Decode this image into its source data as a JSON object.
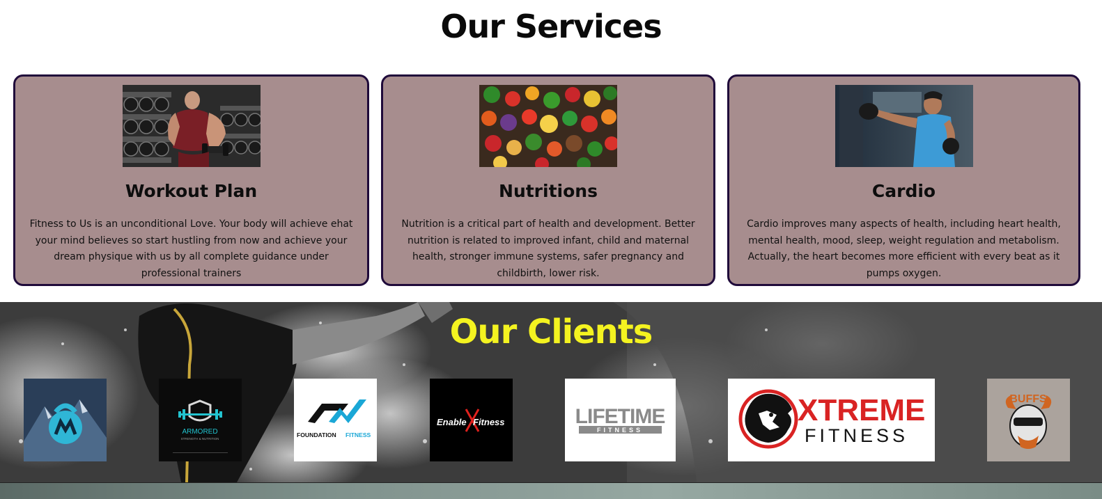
{
  "services": {
    "title": "Our Services",
    "cards": [
      {
        "title": "Workout Plan",
        "description": "Fitness to Us is an unconditional Love. Your body will achieve ehat your mind believes so start hustling from now and achieve your dream physique with us by all complete guidance under professional trainers",
        "image_icon": "bodybuilder-photo"
      },
      {
        "title": "Nutritions",
        "description": "Nutrition is a critical part of health and development. Better nutrition is related to improved infant, child and maternal health, stronger immune systems, safer pregnancy and childbirth, lower risk.",
        "image_icon": "vegetables-photo"
      },
      {
        "title": "Cardio",
        "description": "Cardio improves many aspects of health, including heart health, mental health, mood, sleep, weight regulation and metabolism. Actually, the heart becomes more efficient with every beat as it pumps oxygen.",
        "image_icon": "boxer-photo"
      }
    ]
  },
  "clients": {
    "title": "Our Clients",
    "logos": [
      {
        "name": "mountain-kettlebell-logo"
      },
      {
        "name": "armored-logo",
        "text": "ARMORED",
        "subtext": "STRENGTH & NUTRITION"
      },
      {
        "name": "foundation-fitness-logo",
        "text_a": "FOUNDATION",
        "text_b": "FITNESS"
      },
      {
        "name": "enable-fitness-logo",
        "text_a": "Enable",
        "text_b": "Fitness"
      },
      {
        "name": "lifetime-fitness-logo",
        "text_a": "LIFETIME",
        "text_b": "FITNESS"
      },
      {
        "name": "xtreme-fitness-logo",
        "text_a": "XTREME",
        "text_b": "FITNESS"
      },
      {
        "name": "buffs-logo",
        "text": "BUFFS"
      }
    ]
  },
  "colors": {
    "card_bg": "#a78d8e",
    "card_border": "#1f0a3a",
    "clients_title": "#f4f320",
    "xtreme_red": "#d92323",
    "foundation_blue": "#1aa7d6"
  }
}
